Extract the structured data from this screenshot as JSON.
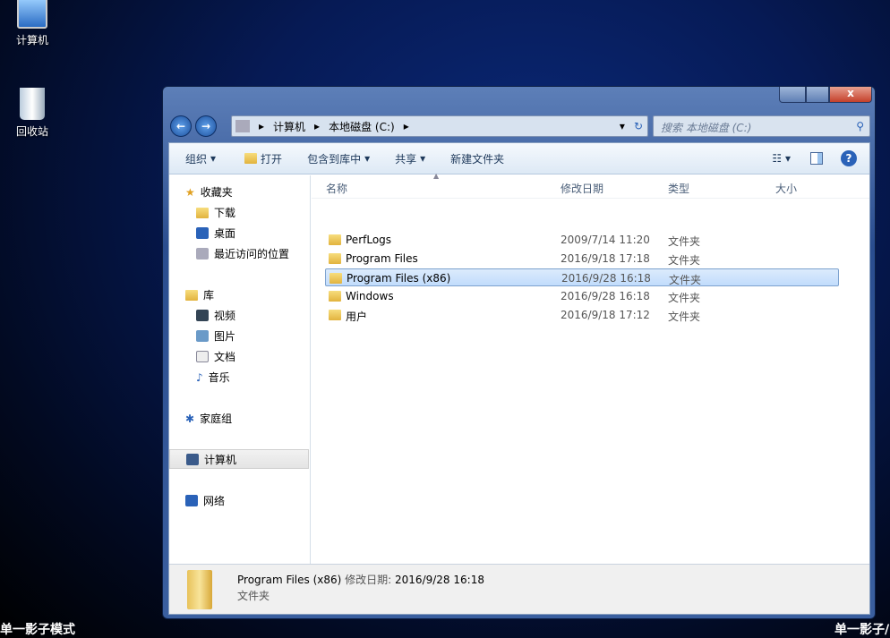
{
  "desktop": {
    "icons": [
      {
        "label": "计算机"
      },
      {
        "label": "回收站"
      }
    ],
    "watermark_left": "单一影子模式",
    "watermark_right": "单一影子/"
  },
  "window": {
    "address": {
      "segments": [
        "计算机",
        "本地磁盘 (C:)"
      ]
    },
    "search_placeholder": "搜索 本地磁盘 (C:)",
    "toolbar": {
      "organize": "组织",
      "open": "打开",
      "include": "包含到库中",
      "share": "共享",
      "new_folder": "新建文件夹"
    },
    "nav": {
      "favorites": "收藏夹",
      "downloads": "下载",
      "desktop": "桌面",
      "recent": "最近访问的位置",
      "libraries": "库",
      "videos": "视频",
      "pictures": "图片",
      "documents": "文档",
      "music": "音乐",
      "homegroup": "家庭组",
      "computer": "计算机",
      "network": "网络"
    },
    "columns": {
      "name": "名称",
      "date": "修改日期",
      "type": "类型",
      "size": "大小"
    },
    "files": [
      {
        "name": "PerfLogs",
        "date": "2009/7/14 11:20",
        "type": "文件夹",
        "selected": false
      },
      {
        "name": "Program Files",
        "date": "2016/9/18 17:18",
        "type": "文件夹",
        "selected": false
      },
      {
        "name": "Program Files (x86)",
        "date": "2016/9/28 16:18",
        "type": "文件夹",
        "selected": true
      },
      {
        "name": "Windows",
        "date": "2016/9/28 16:18",
        "type": "文件夹",
        "selected": false
      },
      {
        "name": "用户",
        "date": "2016/9/18 17:12",
        "type": "文件夹",
        "selected": false
      }
    ],
    "details": {
      "name": "Program Files (x86)",
      "date_label": "修改日期:",
      "date": "2016/9/28 16:18",
      "type": "文件夹"
    }
  }
}
